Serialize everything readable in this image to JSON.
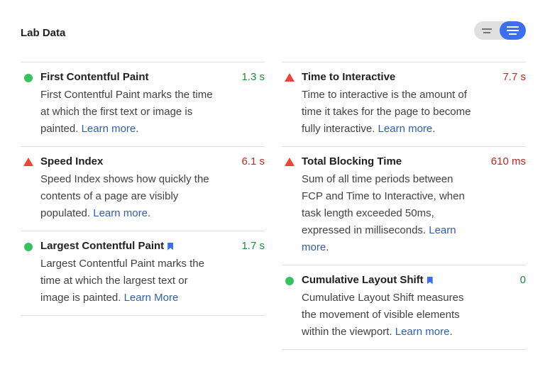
{
  "section": {
    "title": "Lab Data"
  },
  "toggle": {
    "left_icon": "summary-view-icon",
    "right_icon": "list-view-icon"
  },
  "metrics_left": [
    {
      "name": "First Contentful Paint",
      "value": "1.3 s",
      "status": "good",
      "desc": "First Contentful Paint marks the time at which the first text or image is painted.",
      "link": "Learn more",
      "link_suffix": ".",
      "bookmark": false
    },
    {
      "name": "Speed Index",
      "value": "6.1 s",
      "status": "bad",
      "desc": "Speed Index shows how quickly the contents of a page are visibly populated.",
      "link": "Learn more",
      "link_suffix": ".",
      "bookmark": false
    },
    {
      "name": "Largest Contentful Paint",
      "value": "1.7 s",
      "status": "good",
      "desc": "Largest Contentful Paint marks the time at which the largest text or image is painted.",
      "link": "Learn More",
      "link_suffix": "",
      "bookmark": true
    }
  ],
  "metrics_right": [
    {
      "name": "Time to Interactive",
      "value": "7.7 s",
      "status": "bad",
      "desc": "Time to interactive is the amount of time it takes for the page to become fully interactive.",
      "link": "Learn more",
      "link_suffix": ".",
      "bookmark": false
    },
    {
      "name": "Total Blocking Time",
      "value": "610 ms",
      "status": "bad",
      "desc": "Sum of all time periods between FCP and Time to Interactive, when task length exceeded 50ms, expressed in milliseconds.",
      "link": "Learn more",
      "link_suffix": ".",
      "bookmark": false
    },
    {
      "name": "Cumulative Layout Shift",
      "value": "0",
      "status": "good",
      "desc": "Cumulative Layout Shift measures the movement of visible elements within the viewport.",
      "link": "Learn more",
      "link_suffix": ".",
      "bookmark": true
    }
  ],
  "colors": {
    "good": "#36c35b",
    "bad": "#e8453c",
    "accent": "#3b6ff0",
    "link": "#2f5fb3"
  }
}
